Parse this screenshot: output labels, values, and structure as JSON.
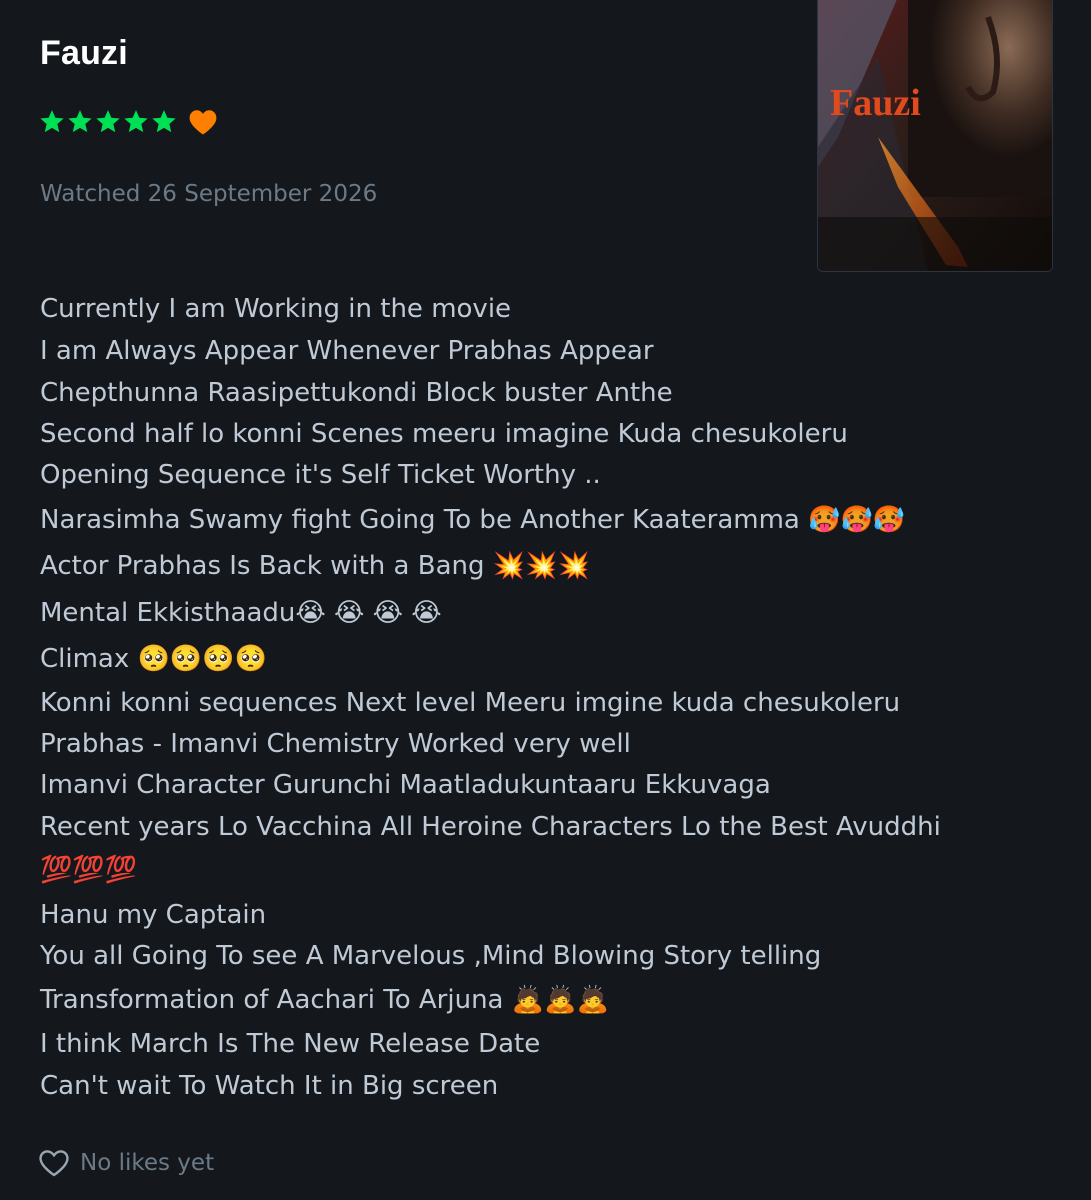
{
  "film": {
    "title": "Fauzi",
    "poster_title": "Fauzi",
    "rating_stars": 5,
    "liked": true
  },
  "watched_text": "Watched 26 September 2026",
  "review_lines": [
    "Currently I am Working in the movie",
    "I am Always Appear Whenever Prabhas Appear",
    "Chepthunna Raasipettukondi Block buster Anthe",
    "Second half lo konni Scenes meeru imagine Kuda chesukoleru",
    "Opening Sequence it's Self Ticket Worthy ..",
    "Narasimha Swamy fight Going To be Another Kaateramma 🥵🥵🥵",
    "Actor Prabhas Is Back with a Bang 💥💥💥",
    "Mental Ekkisthaadu😭 😭 😭 😭",
    "Climax 🥺🥺🥺🥺",
    "Konni konni sequences Next level Meeru imgine kuda chesukoleru",
    "Prabhas - Imanvi Chemistry Worked very well",
    "Imanvi Character Gurunchi Maatladukuntaaru Ekkuvaga",
    "Recent years Lo Vacchina All Heroine Characters Lo the Best Avuddhi",
    "💯💯💯",
    "Hanu my Captain",
    "You all Going To see A Marvelous ,Mind Blowing Story telling",
    "Transformation of Aachari To Arjuna 🙇🙇🙇",
    "I think March Is The New Release Date",
    "Can't wait To Watch It in Big screen"
  ],
  "likes_text": "No likes yet",
  "colors": {
    "background": "#14181c",
    "star": "#00e054",
    "heart": "#ff8000",
    "title": "#ffffff",
    "muted": "#6c7a88",
    "text": "#bfcad6"
  },
  "icons": {
    "star": "star-icon",
    "liked": "heart-filled-icon",
    "likes": "heart-outline-icon"
  }
}
